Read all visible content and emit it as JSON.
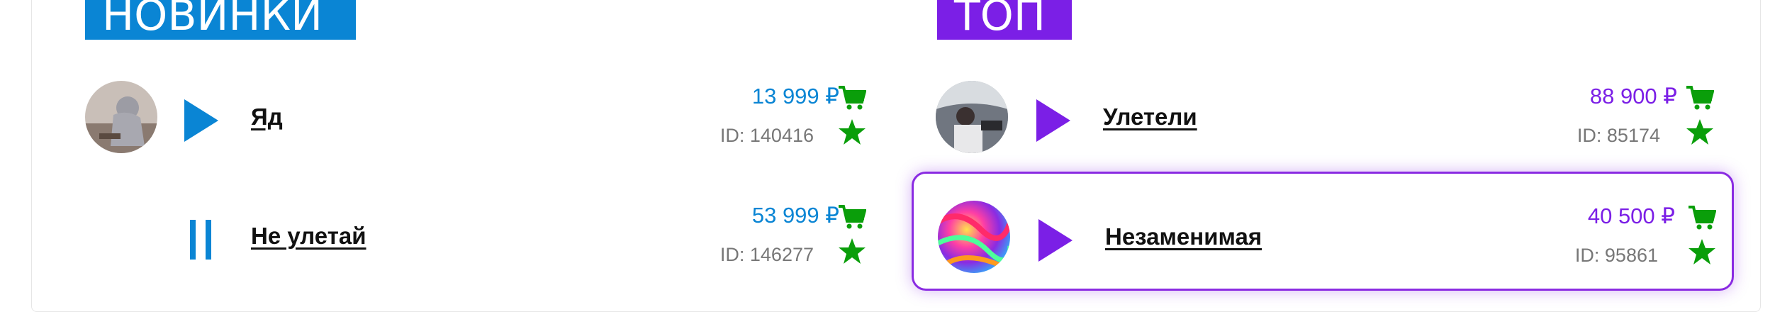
{
  "sections": {
    "new": {
      "heading": "НОВИНКИ"
    },
    "top": {
      "heading": "ТОП"
    }
  },
  "colors": {
    "new_accent": "#0a85d4",
    "top_accent": "#7b1fe6",
    "action_green": "#0a9e0a"
  },
  "tracks_new": [
    {
      "title": "Яд",
      "price": "13 999 ₽",
      "id": "ID: 140416",
      "cover": "hooded-person-photo",
      "state": "stopped"
    },
    {
      "title": "Не улетай",
      "price": "53 999 ₽",
      "id": "ID: 146277",
      "cover": "sound-wave-icon",
      "state": "playing"
    }
  ],
  "tracks_top": [
    {
      "title": "Улетели",
      "price": "88 900 ₽",
      "id": "ID: 85174",
      "cover": "car-interior-photo",
      "state": "stopped"
    },
    {
      "title": "Незаменимая",
      "price": "40 500 ₽",
      "id": "ID: 95861",
      "cover": "colorful-abstract-art",
      "state": "stopped",
      "active": true
    }
  ],
  "icons": {
    "cart": "cart-icon",
    "favorite": "star-icon",
    "play": "play-icon",
    "pause": "pause-icon"
  }
}
